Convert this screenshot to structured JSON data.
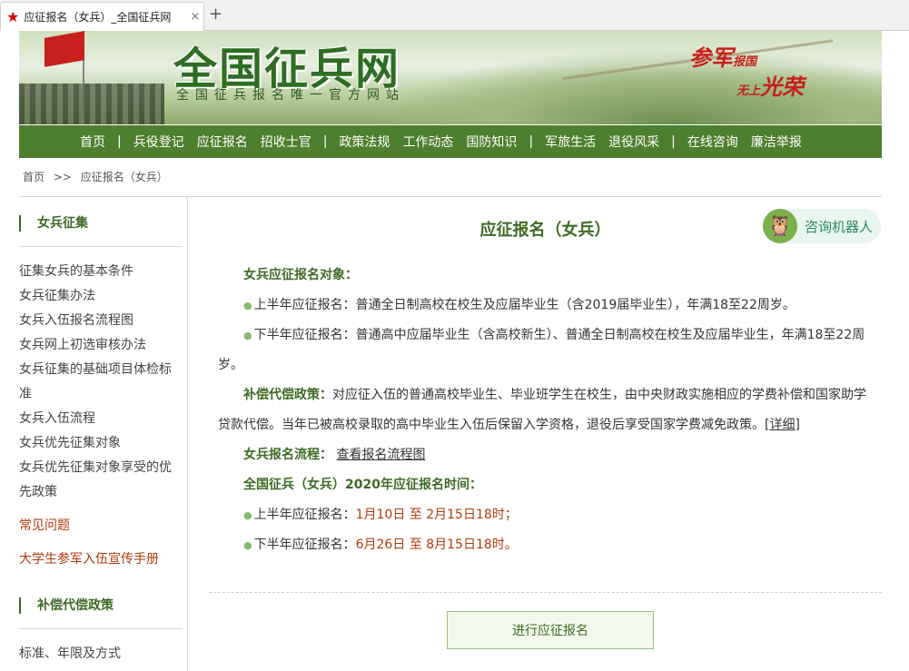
{
  "browser": {
    "tab_title": "应征报名（女兵）_全国征兵网",
    "close": "×",
    "new_tab": "+"
  },
  "header": {
    "logo": "全国征兵网",
    "slogan": "全国征兵报名唯一官方网站",
    "motto_line1": "参军",
    "motto_line1_small": "报国",
    "motto_line2_small": "无上",
    "motto_line2": "光荣"
  },
  "nav": {
    "items": [
      "首页",
      "兵役登记",
      "应征报名",
      "招收士官",
      "政策法规",
      "工作动态",
      "国防知识",
      "军旅生活",
      "退役风采",
      "在线咨询",
      "廉洁举报"
    ]
  },
  "breadcrumb": {
    "home": "首页",
    "sep": ">>",
    "current": "应征报名（女兵）"
  },
  "sidebar": {
    "section1_title": "女兵征集",
    "links": [
      "征集女兵的基本条件",
      "女兵征集办法",
      "女兵入伍报名流程图",
      "女兵网上初选审核办法",
      "女兵征集的基础项目体检标准",
      "女兵入伍流程",
      "女兵优先征集对象",
      "女兵优先征集对象享受的优先政策"
    ],
    "faq": "常见问题",
    "handbook": "大学生参军入伍宣传手册",
    "section2_title": "补偿代偿政策",
    "section2_links": [
      "标准、年限及方式"
    ]
  },
  "main": {
    "title": "应征报名（女兵）",
    "robot_label": "咨询机器人",
    "target_heading": "女兵应征报名对象：",
    "first_half_label": "上半年应征报名：",
    "first_half_text": "普通全日制高校在校生及应届毕业生（含2019届毕业生），年满18至22周岁。",
    "second_half_label": "下半年应征报名：",
    "second_half_text": "普通高中应届毕业生（含高校新生）、普通全日制高校在校生及应届毕业生，年满18至22周岁。",
    "compensation_heading": "补偿代偿政策：",
    "compensation_text": "对应征入伍的普通高校毕业生、毕业班学生在校生，由中央财政实施相应的学费补偿和国家助学贷款代偿。当年已被高校录取的高中毕业生入伍后保留入学资格，退役后享受国家学费减免政策。",
    "details_link": "[详细]",
    "process_heading": "女兵报名流程：",
    "process_link": "查看报名流程图",
    "time_heading": "全国征兵（女兵）2020年应征报名时间：",
    "time_first_label": "上半年应征报名：",
    "time_first_value": "1月10日 至 2月15日18时；",
    "time_second_label": "下半年应征报名：",
    "time_second_value": "6月26日 至 8月15日18时。",
    "button_label": "进行应征报名"
  }
}
